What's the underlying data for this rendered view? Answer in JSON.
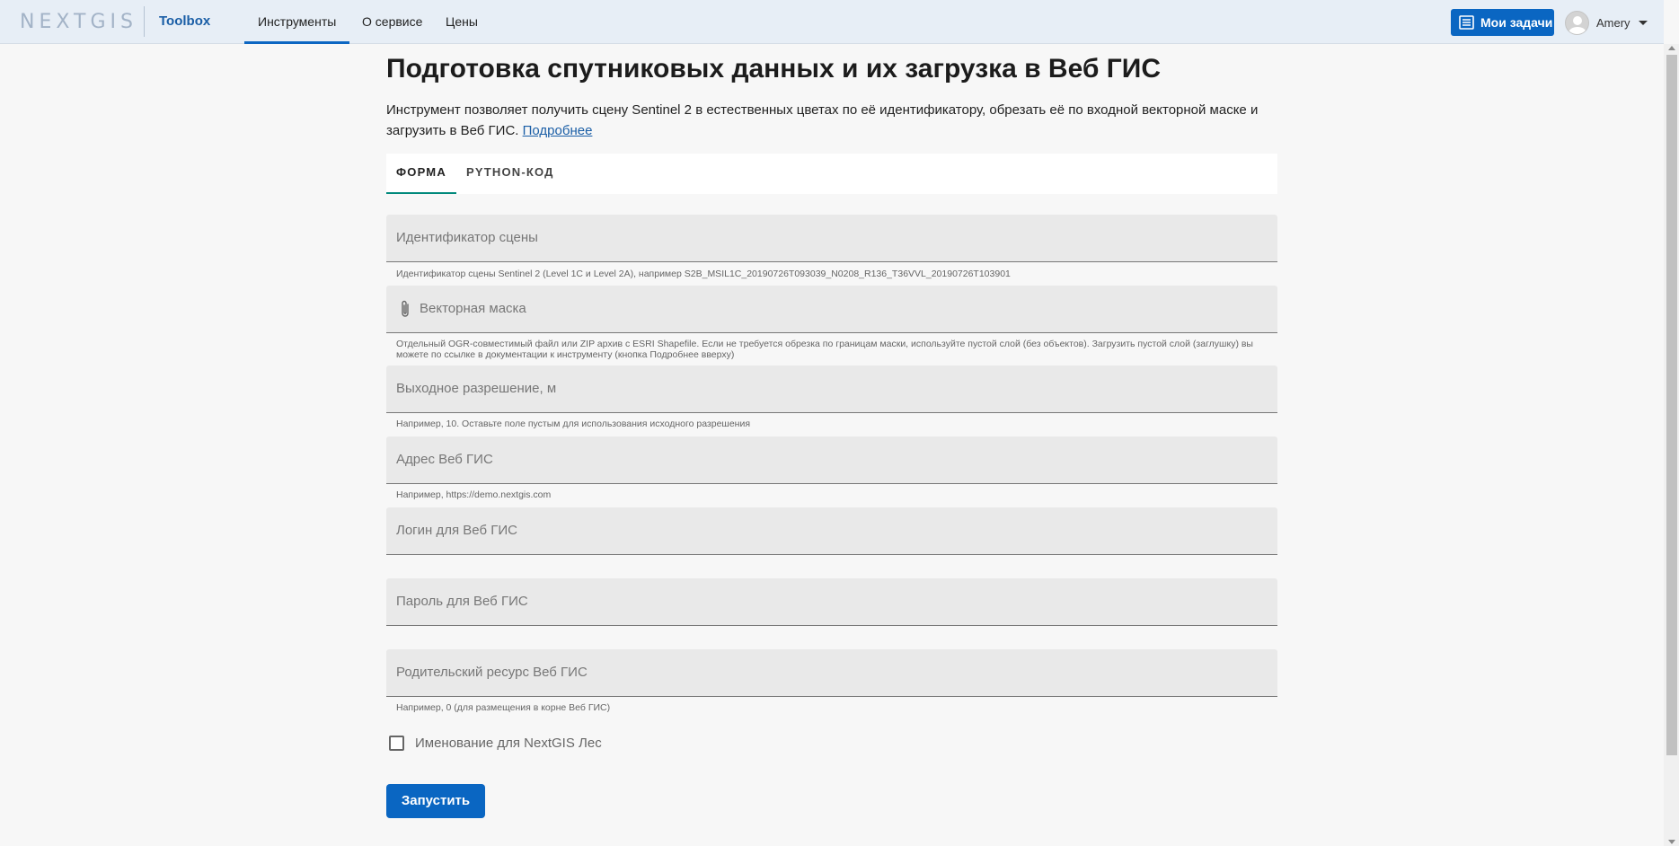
{
  "header": {
    "logo_text": "NEXTGIS",
    "product": "Toolbox",
    "nav": [
      "Инструменты",
      "О сервисе",
      "Цены"
    ],
    "tasks_button": "Мои задачи",
    "user_name": "Amery"
  },
  "page": {
    "title": "Подготовка спутниковых данных и их загрузка в Веб ГИС",
    "description": "Инструмент позволяет получить сцену Sentinel 2 в естественных цветах по её идентификатору, обрезать её по входной векторной маске и загрузить в Веб ГИС.",
    "more_link": "Подробнее"
  },
  "tabs": [
    "Форма",
    "Python-код"
  ],
  "fields": [
    {
      "placeholder": "Идентификатор сцены",
      "help": "Идентификатор сцены Sentinel 2 (Level 1C и Level 2A), например S2B_MSIL1C_20190726T093039_N0208_R136_T36VVL_20190726T103901"
    },
    {
      "placeholder": "Векторная маска",
      "help": "Отдельный OGR-совместимый файл или ZIP архив с ESRI Shapefile. Если не требуется обрезка по границам маски, используйте пустой слой (без объектов). Загрузить пустой слой (заглушку) вы можете по ссылке в документации к инструменту (кнопка Подробнее вверху)"
    },
    {
      "placeholder": "Выходное разрешение, м",
      "help": "Например, 10. Оставьте поле пустым для использования исходного разрешения"
    },
    {
      "placeholder": "Адрес Веб ГИС",
      "help": "Например, https://demo.nextgis.com"
    },
    {
      "placeholder": "Логин для Веб ГИС",
      "help": ""
    },
    {
      "placeholder": "Пароль для Веб ГИС",
      "help": ""
    },
    {
      "placeholder": "Родительский ресурс Веб ГИС",
      "help": "Например, 0 (для размещения в корне Веб ГИС)"
    }
  ],
  "checkbox_label": "Именование для NextGIS Лес",
  "run_button": "Запустить",
  "colors": {
    "accent": "#0a66c2",
    "tab_indicator": "#00897b",
    "header_bg": "#e7eef6"
  }
}
